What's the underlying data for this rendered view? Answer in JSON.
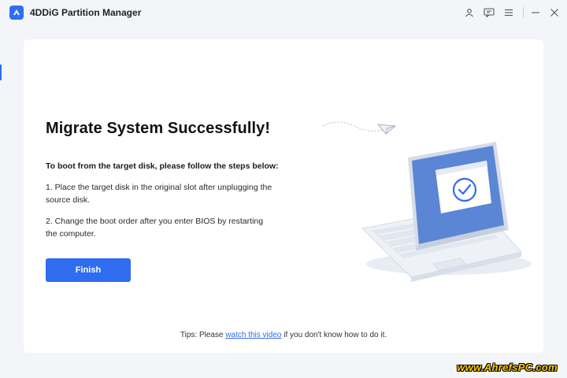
{
  "window": {
    "title": "4DDiG Partition Manager",
    "buttons": [
      "account-icon",
      "feedback-icon",
      "menu-icon",
      "minimize-icon",
      "close-icon"
    ]
  },
  "main": {
    "heading": "Migrate System Successfully!",
    "subheading": "To boot from the target disk, please follow the steps below:",
    "steps": [
      "1. Place the target disk in the original slot after unplugging the source disk.",
      "2. Change the boot order after you enter BIOS by restarting the computer."
    ],
    "finish_label": "Finish",
    "tips_prefix": "Tips: Please ",
    "tips_link": "watch this video",
    "tips_suffix": " if you don't know how to do it."
  },
  "watermark": "www.AhrefsPC.com",
  "colors": {
    "accent": "#2f6cf0",
    "background": "#f4f5f8",
    "card": "#ffffff",
    "check": "#2f6cf0"
  }
}
